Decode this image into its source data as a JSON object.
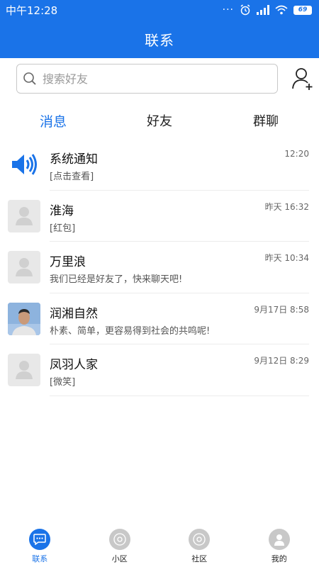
{
  "status_bar": {
    "time": "中午12:28",
    "dots": "···",
    "battery": "69",
    "icons": [
      "alarm-icon",
      "signal-icon",
      "wifi-icon",
      "battery-icon"
    ]
  },
  "header": {
    "title": "联系"
  },
  "search": {
    "placeholder": "搜索好友"
  },
  "tabs": [
    {
      "label": "消息",
      "active": true
    },
    {
      "label": "好友",
      "active": false
    },
    {
      "label": "群聊",
      "active": false
    }
  ],
  "conversations": [
    {
      "name": "系统通知",
      "time": "12:20",
      "preview": "[点击查看]",
      "avatar": "speaker-icon"
    },
    {
      "name": "淮海",
      "time": "昨天 16:32",
      "preview": "[红包]",
      "avatar": "default-avatar"
    },
    {
      "name": "万里浪",
      "time": "昨天 10:34",
      "preview": "我们已经是好友了，快来聊天吧!",
      "avatar": "default-avatar"
    },
    {
      "name": "润湘自然",
      "time": "9月17日 8:58",
      "preview": "朴素、简单，更容易得到社会的共鸣呢!",
      "avatar": "photo-avatar"
    },
    {
      "name": "凤羽人家",
      "time": "9月12日 8:29",
      "preview": "[微笑]",
      "avatar": "default-avatar"
    }
  ],
  "bottom_nav": [
    {
      "label": "联系",
      "active": true,
      "icon": "chat-icon"
    },
    {
      "label": "小区",
      "active": false,
      "icon": "community-icon"
    },
    {
      "label": "社区",
      "active": false,
      "icon": "district-icon"
    },
    {
      "label": "我的",
      "active": false,
      "icon": "profile-icon"
    }
  ],
  "colors": {
    "primary": "#1a73e8",
    "inactive_icon": "#c8c8c8",
    "divider": "#ececec"
  }
}
